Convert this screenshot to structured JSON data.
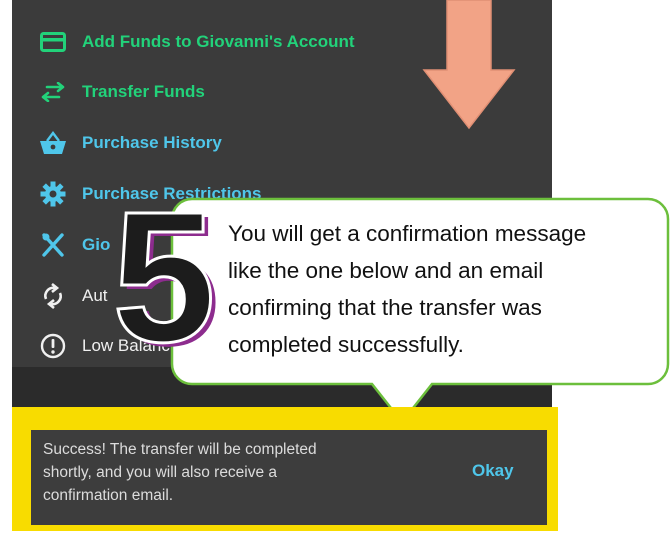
{
  "menu": {
    "items": [
      {
        "label": "Add Funds to Giovanni's Account",
        "icon": "credit-card-icon",
        "color": "#22d27a"
      },
      {
        "label": "Transfer Funds",
        "icon": "transfer-arrows-icon",
        "color": "#22d27a"
      },
      {
        "label": "Purchase History",
        "icon": "basket-icon",
        "color": "#4fc6ea"
      },
      {
        "label": "Purchase Restrictions",
        "icon": "gear-icon",
        "color": "#4fc6ea"
      },
      {
        "label": "Gio",
        "icon": "utensils-icon",
        "color": "#4fc6ea"
      },
      {
        "label": "Aut",
        "icon": "refresh-icon",
        "color": "#f0f0f0"
      },
      {
        "label": "Low Balanc",
        "icon": "alert-circle-icon",
        "color": "#f0f0f0"
      }
    ]
  },
  "step_number": "5",
  "callout": {
    "lines": [
      "You will get a confirmation message",
      "like the one below and an email",
      "confirming that the transfer was",
      "completed successfully."
    ]
  },
  "success": {
    "lines": [
      "Success! The transfer will be completed",
      "shortly, and you will also receive a",
      "confirmation email."
    ],
    "button_label": "Okay"
  },
  "colors": {
    "panel_bg": "#3b3b3b",
    "highlight_border": "#f8dc00",
    "callout_border": "#6cbf3c",
    "arrow": "#f2a386",
    "step_number_outline": "#8d2c8e"
  }
}
